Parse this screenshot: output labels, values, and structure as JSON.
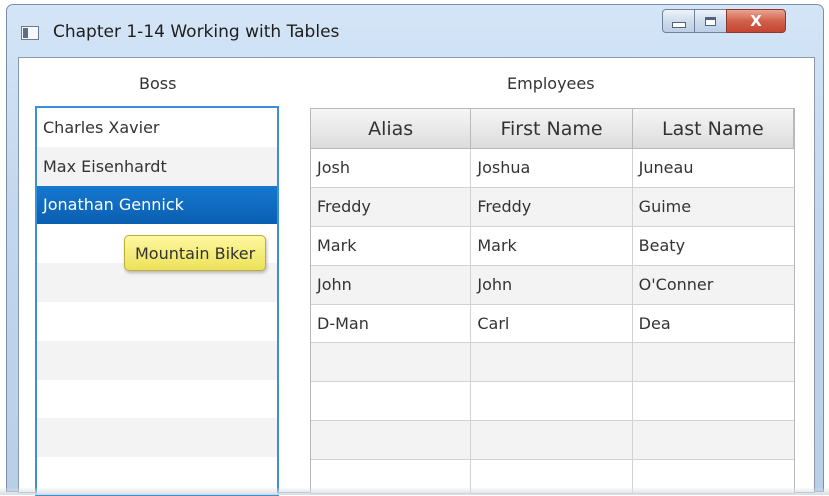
{
  "window": {
    "title": "Chapter 1-14 Working with Tables",
    "close_glyph": "X"
  },
  "boss": {
    "heading": "Boss",
    "items": [
      "Charles Xavier",
      "Max Eisenhardt",
      "Jonathan Gennick"
    ],
    "selected_index": 2,
    "tooltip": "Mountain Biker"
  },
  "employees": {
    "heading": "Employees",
    "columns": [
      "Alias",
      "First Name",
      "Last Name"
    ],
    "rows": [
      [
        "Josh",
        "Joshua",
        "Juneau"
      ],
      [
        "Freddy",
        "Freddy",
        "Guime"
      ],
      [
        "Mark",
        "Mark",
        "Beaty"
      ],
      [
        "John",
        "John",
        "O'Conner"
      ],
      [
        "D-Man",
        "Carl",
        "Dea"
      ]
    ]
  },
  "colors": {
    "selection": "#0a6bc4",
    "focus_border": "#3a8fd6",
    "tooltip_bg": "#f5ec7a",
    "close_button": "#d1614a"
  }
}
